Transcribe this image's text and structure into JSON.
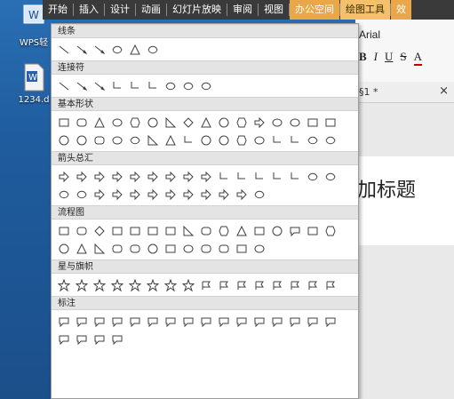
{
  "menubar": {
    "items": [
      {
        "label": "开始"
      },
      {
        "label": "插入"
      },
      {
        "label": "设计"
      },
      {
        "label": "动画"
      },
      {
        "label": "幻灯片放映"
      },
      {
        "label": "审阅"
      },
      {
        "label": "视图"
      },
      {
        "label": "办公空间"
      },
      {
        "label": "绘图工具"
      },
      {
        "label": "效"
      }
    ]
  },
  "desktop": {
    "icons": [
      {
        "label": "WPS轻",
        "icon": "wps-app-icon"
      },
      {
        "label": "1234.d",
        "icon": "word-document-icon"
      }
    ]
  },
  "doc": {
    "font_name": "Arial",
    "fmt": {
      "bold": "B",
      "italic": "I",
      "underline": "U",
      "strike": "S",
      "font_color": "A"
    },
    "tab_name": "§1 *",
    "tab_close": "×",
    "slide_title": "加标题"
  },
  "panel": {
    "sections": [
      {
        "title": "线条",
        "count": 6
      },
      {
        "title": "连接符",
        "count": 9
      },
      {
        "title": "基本形状",
        "count": 32
      },
      {
        "title": "箭头总汇",
        "count": 28
      },
      {
        "title": "流程图",
        "count": 28
      },
      {
        "title": "星与旗帜",
        "count": 16
      },
      {
        "title": "标注",
        "count": 20
      }
    ]
  }
}
